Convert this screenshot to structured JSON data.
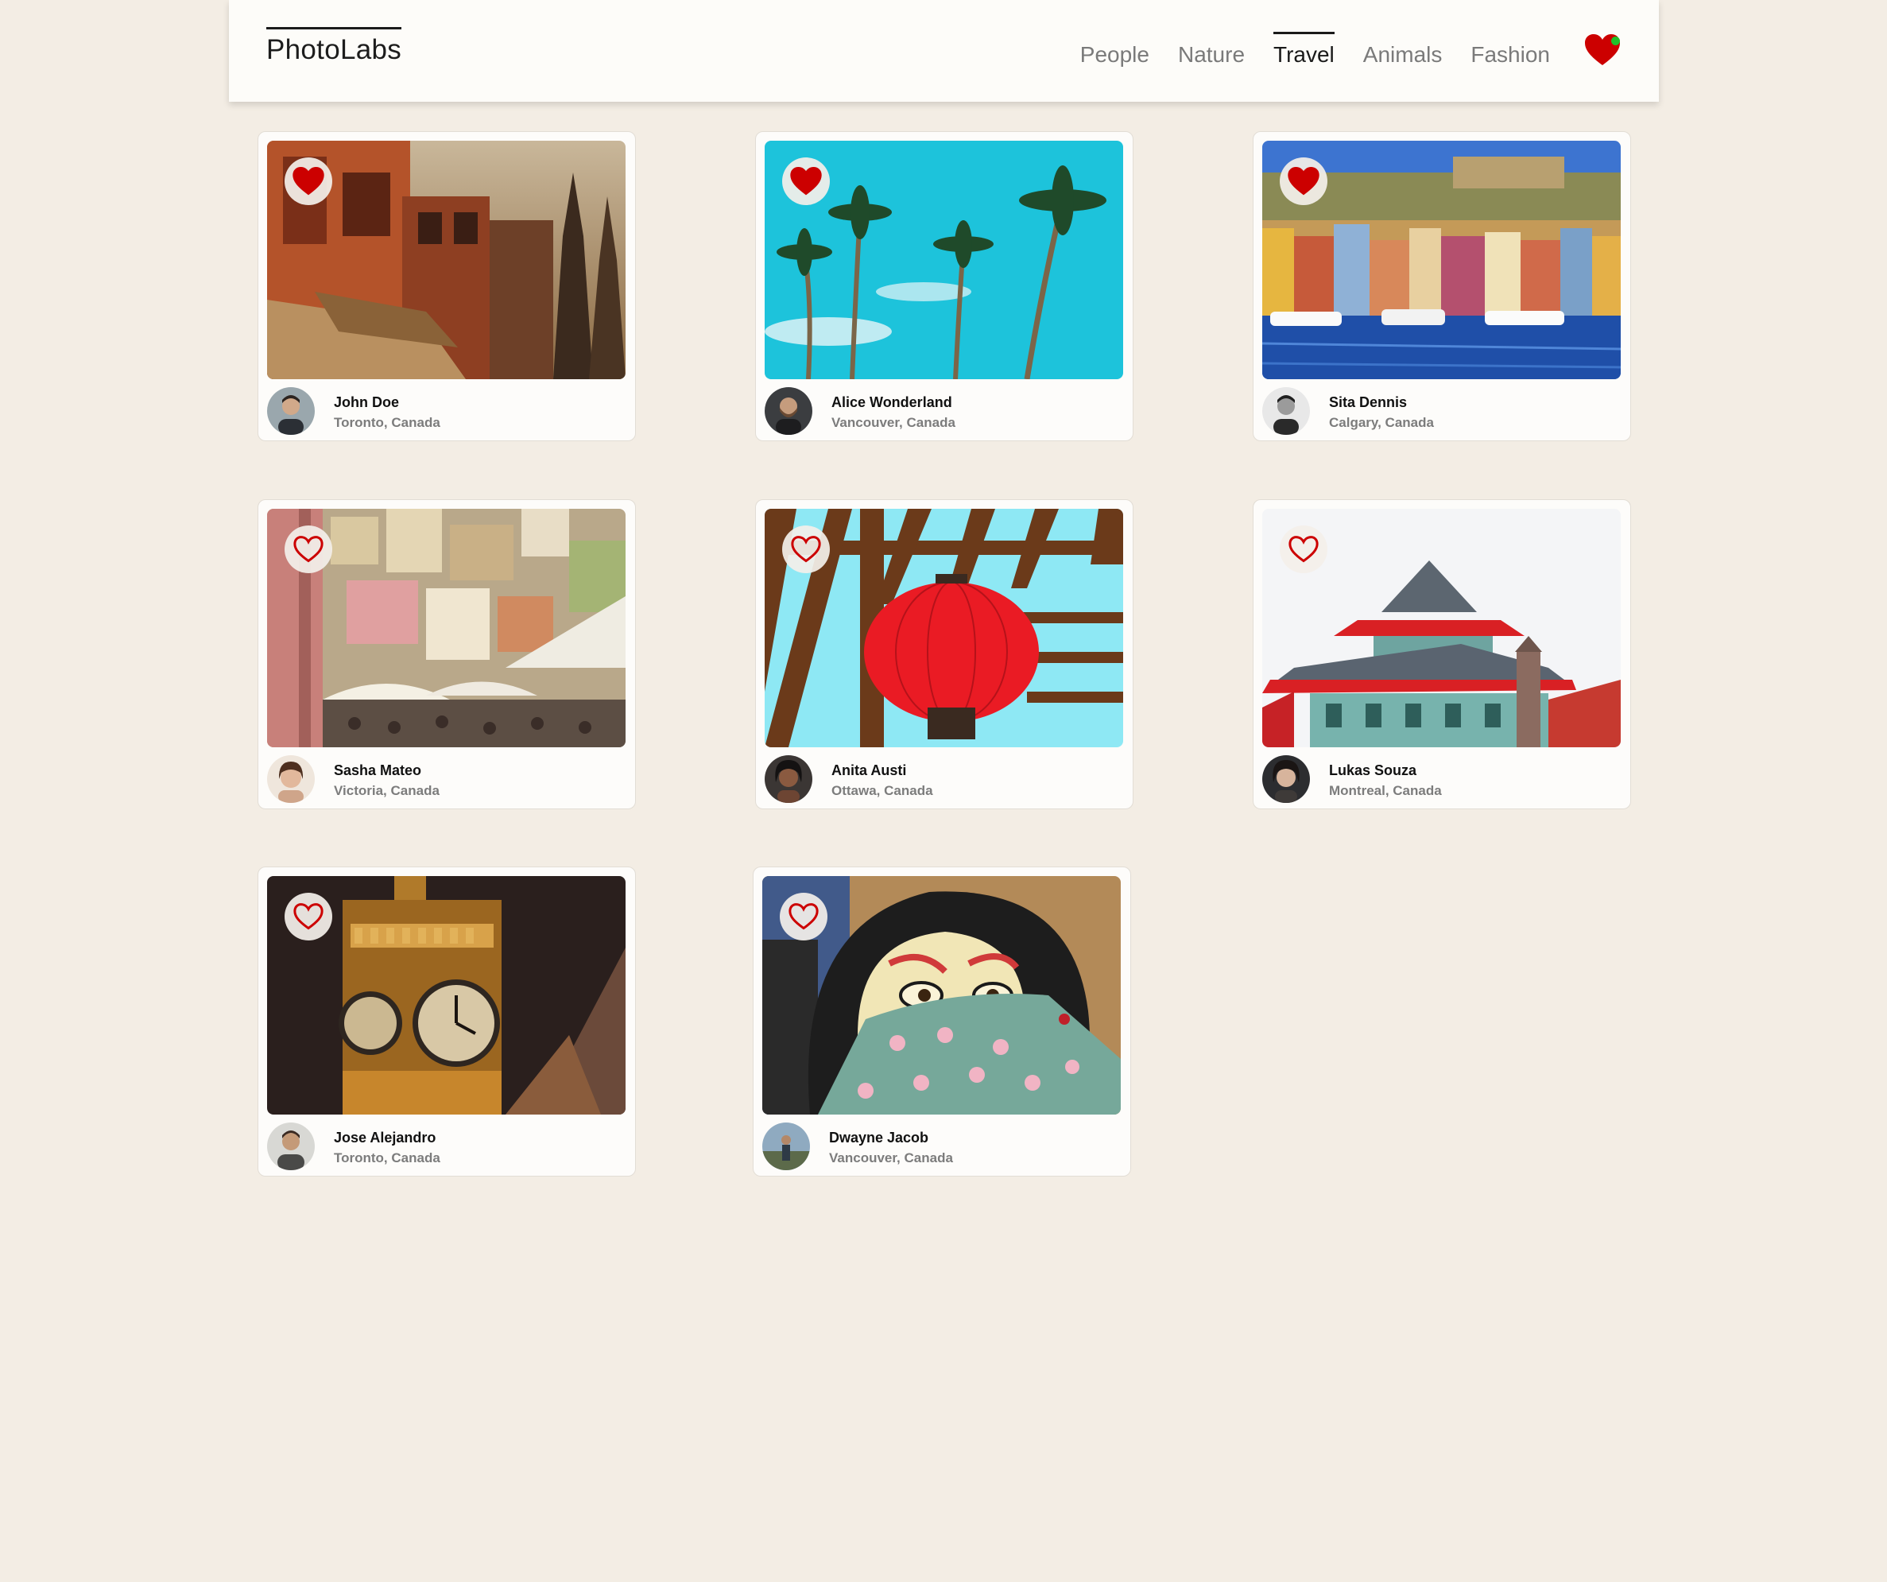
{
  "app": {
    "logo": "PhotoLabs"
  },
  "nav": {
    "topics": [
      "People",
      "Nature",
      "Travel",
      "Animals",
      "Fashion"
    ],
    "active_topic": "Travel",
    "fav_icon": "heart-icon",
    "has_notification": true,
    "colors": {
      "heart": "#cc0000",
      "notification": "#1fc22a"
    }
  },
  "photos": [
    {
      "name": "John Doe",
      "location": "Toronto, Canada",
      "favorited": true,
      "image": "street-buildings-dusk"
    },
    {
      "name": "Alice Wonderland",
      "location": "Vancouver, Canada",
      "favorited": true,
      "image": "palm-trees-sky"
    },
    {
      "name": "Sita Dennis",
      "location": "Calgary, Canada",
      "favorited": true,
      "image": "harbor-colorful-houses"
    },
    {
      "name": "Sasha Mateo",
      "location": "Victoria, Canada",
      "favorited": false,
      "image": "hillside-town-umbrellas"
    },
    {
      "name": "Anita Austi",
      "location": "Ottawa, Canada",
      "favorited": false,
      "image": "red-lantern-pergola"
    },
    {
      "name": "Lukas Souza",
      "location": "Montreal, Canada",
      "favorited": false,
      "image": "pagoda-building"
    },
    {
      "name": "Jose Alejandro",
      "location": "Toronto, Canada",
      "favorited": false,
      "image": "clock-tower-night"
    },
    {
      "name": "Dwayne Jacob",
      "location": "Vancouver, Canada",
      "favorited": false,
      "image": "geisha-mural"
    }
  ]
}
